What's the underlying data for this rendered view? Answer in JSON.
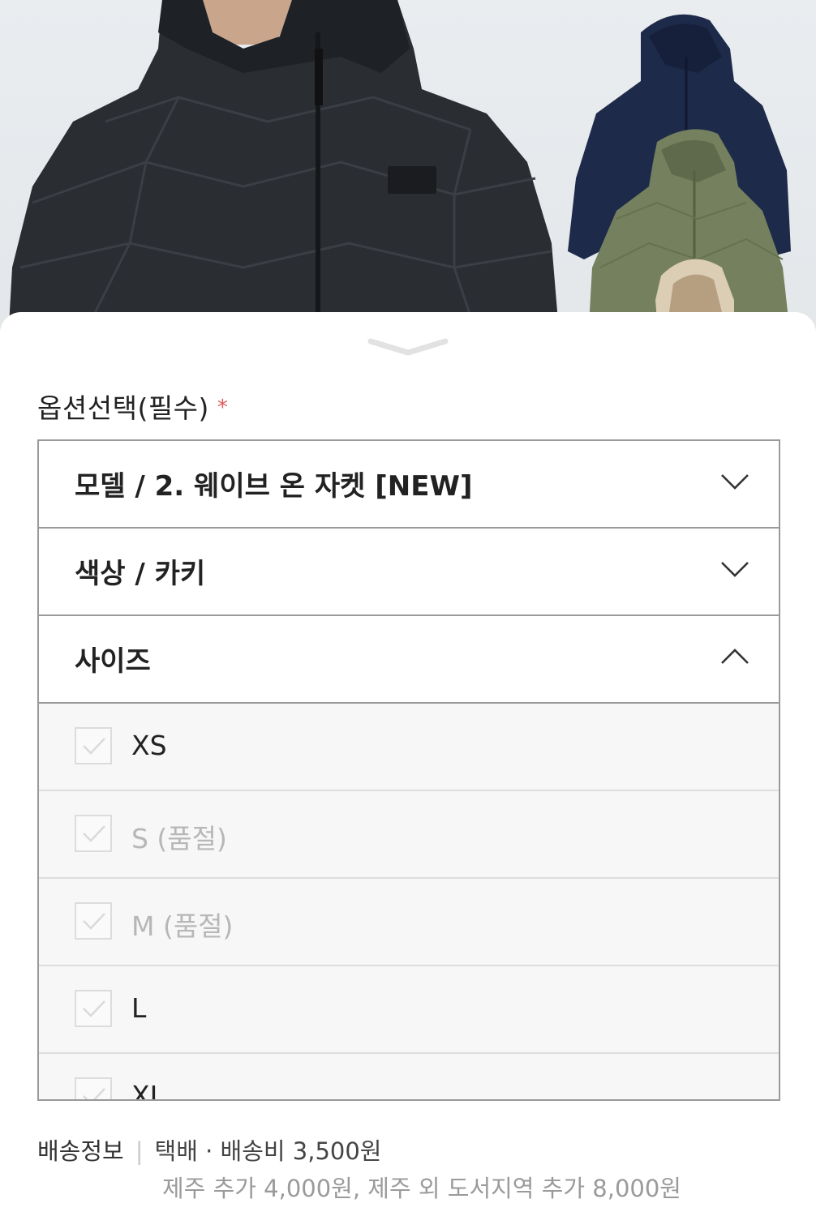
{
  "hero": {
    "image_description_icon": "jacket-product-photo"
  },
  "option_section": {
    "title": "옵션선택(필수)",
    "required_mark": "*",
    "rows": [
      {
        "label": "모델 / 2. 웨이브 온 자켓 [NEW]",
        "state": "collapsed"
      },
      {
        "label": "색상 / 카키",
        "state": "collapsed"
      },
      {
        "label": "사이즈",
        "state": "expanded"
      }
    ],
    "sizes": [
      {
        "label": "XS",
        "soldout": false
      },
      {
        "label": "S (품절)",
        "soldout": true
      },
      {
        "label": "M (품절)",
        "soldout": true
      },
      {
        "label": "L",
        "soldout": false
      },
      {
        "label": "XL",
        "soldout": false
      }
    ]
  },
  "delivery": {
    "heading": "배송정보",
    "divider": "|",
    "method": "택배 · 배송비 3,500원",
    "extra": "제주 추가 4,000원, 제주 외 도서지역 추가 8,000원"
  },
  "colors": {
    "border": "#9a9a9a",
    "required": "#e05a5a",
    "soldout_text": "#b7b7b7",
    "size_bg": "#f7f7f7"
  }
}
